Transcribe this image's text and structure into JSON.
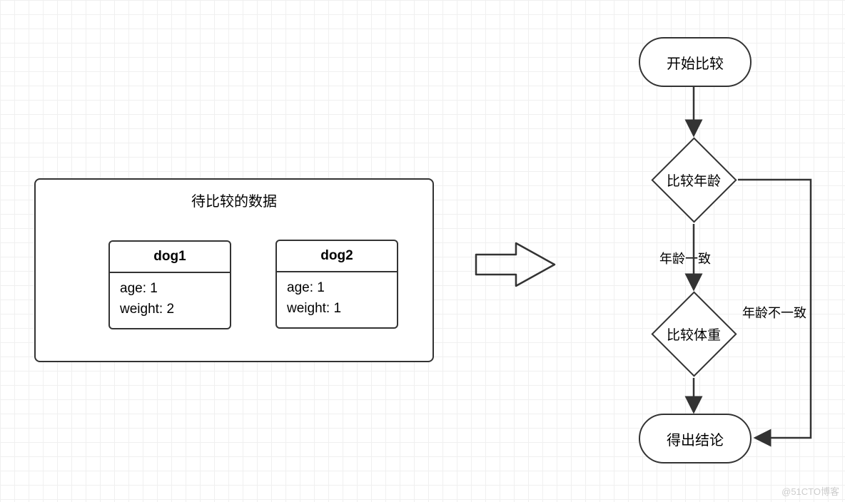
{
  "panel": {
    "title": "待比较的数据",
    "cards": [
      {
        "name": "dog1",
        "lines": [
          "age: 1",
          "weight: 2"
        ]
      },
      {
        "name": "dog2",
        "lines": [
          "age: 1",
          "weight: 1"
        ]
      }
    ]
  },
  "flow": {
    "start": "开始比较",
    "decision1": "比较年龄",
    "edge_same_age": "年龄一致",
    "decision2": "比较体重",
    "end": "得出结论",
    "edge_diff_age": "年龄不一致"
  },
  "watermark": "@51CTO博客"
}
